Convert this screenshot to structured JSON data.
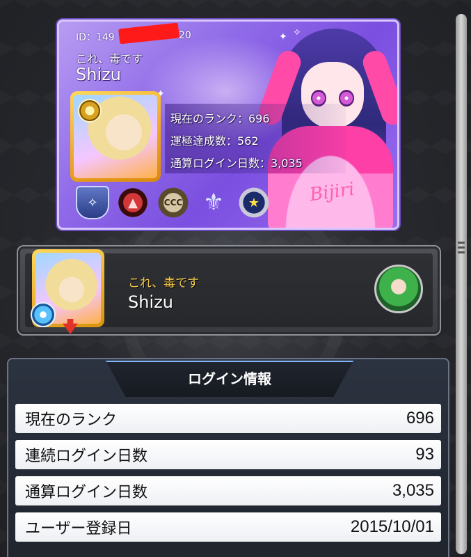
{
  "profile_card": {
    "id_prefix": "ID：149",
    "id_suffix": "20",
    "subtitle": "これ、毒です",
    "name": "Shizu",
    "stats": [
      "現在のランク：696",
      "運極達成数：562",
      "通算ログイン日数：3,035"
    ],
    "emblem_icons": [
      "shield-emblem-icon",
      "red-seal-emblem-icon",
      "ccc-emblem-icon",
      "fleur-emblem-icon",
      "round-badge-emblem-icon"
    ],
    "signature": "Bijiri",
    "colors": {
      "card_bg": "#8f6ae8",
      "redaction": "#ff1a1a"
    }
  },
  "friend": {
    "subtitle": "これ、毒です",
    "name": "Shizu",
    "colors": {
      "subtitle": "#f2c94c"
    }
  },
  "login_info": {
    "title": "ログイン情報",
    "rows": [
      {
        "label": "現在のランク",
        "value": "696"
      },
      {
        "label": "連続ログイン日数",
        "value": "93"
      },
      {
        "label": "通算ログイン日数",
        "value": "3,035"
      },
      {
        "label": "ユーザー登録日",
        "value": "2015/10/01"
      }
    ]
  }
}
